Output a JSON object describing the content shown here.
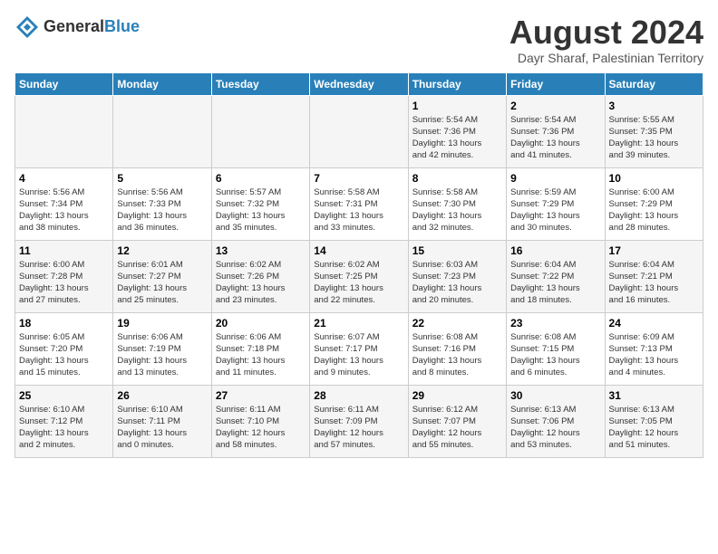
{
  "header": {
    "logo_line1": "General",
    "logo_line2": "Blue",
    "month_title": "August 2024",
    "subtitle": "Dayr Sharaf, Palestinian Territory"
  },
  "days_of_week": [
    "Sunday",
    "Monday",
    "Tuesday",
    "Wednesday",
    "Thursday",
    "Friday",
    "Saturday"
  ],
  "weeks": [
    [
      {
        "day": "",
        "info": ""
      },
      {
        "day": "",
        "info": ""
      },
      {
        "day": "",
        "info": ""
      },
      {
        "day": "",
        "info": ""
      },
      {
        "day": "1",
        "info": "Sunrise: 5:54 AM\nSunset: 7:36 PM\nDaylight: 13 hours\nand 42 minutes."
      },
      {
        "day": "2",
        "info": "Sunrise: 5:54 AM\nSunset: 7:36 PM\nDaylight: 13 hours\nand 41 minutes."
      },
      {
        "day": "3",
        "info": "Sunrise: 5:55 AM\nSunset: 7:35 PM\nDaylight: 13 hours\nand 39 minutes."
      }
    ],
    [
      {
        "day": "4",
        "info": "Sunrise: 5:56 AM\nSunset: 7:34 PM\nDaylight: 13 hours\nand 38 minutes."
      },
      {
        "day": "5",
        "info": "Sunrise: 5:56 AM\nSunset: 7:33 PM\nDaylight: 13 hours\nand 36 minutes."
      },
      {
        "day": "6",
        "info": "Sunrise: 5:57 AM\nSunset: 7:32 PM\nDaylight: 13 hours\nand 35 minutes."
      },
      {
        "day": "7",
        "info": "Sunrise: 5:58 AM\nSunset: 7:31 PM\nDaylight: 13 hours\nand 33 minutes."
      },
      {
        "day": "8",
        "info": "Sunrise: 5:58 AM\nSunset: 7:30 PM\nDaylight: 13 hours\nand 32 minutes."
      },
      {
        "day": "9",
        "info": "Sunrise: 5:59 AM\nSunset: 7:29 PM\nDaylight: 13 hours\nand 30 minutes."
      },
      {
        "day": "10",
        "info": "Sunrise: 6:00 AM\nSunset: 7:29 PM\nDaylight: 13 hours\nand 28 minutes."
      }
    ],
    [
      {
        "day": "11",
        "info": "Sunrise: 6:00 AM\nSunset: 7:28 PM\nDaylight: 13 hours\nand 27 minutes."
      },
      {
        "day": "12",
        "info": "Sunrise: 6:01 AM\nSunset: 7:27 PM\nDaylight: 13 hours\nand 25 minutes."
      },
      {
        "day": "13",
        "info": "Sunrise: 6:02 AM\nSunset: 7:26 PM\nDaylight: 13 hours\nand 23 minutes."
      },
      {
        "day": "14",
        "info": "Sunrise: 6:02 AM\nSunset: 7:25 PM\nDaylight: 13 hours\nand 22 minutes."
      },
      {
        "day": "15",
        "info": "Sunrise: 6:03 AM\nSunset: 7:23 PM\nDaylight: 13 hours\nand 20 minutes."
      },
      {
        "day": "16",
        "info": "Sunrise: 6:04 AM\nSunset: 7:22 PM\nDaylight: 13 hours\nand 18 minutes."
      },
      {
        "day": "17",
        "info": "Sunrise: 6:04 AM\nSunset: 7:21 PM\nDaylight: 13 hours\nand 16 minutes."
      }
    ],
    [
      {
        "day": "18",
        "info": "Sunrise: 6:05 AM\nSunset: 7:20 PM\nDaylight: 13 hours\nand 15 minutes."
      },
      {
        "day": "19",
        "info": "Sunrise: 6:06 AM\nSunset: 7:19 PM\nDaylight: 13 hours\nand 13 minutes."
      },
      {
        "day": "20",
        "info": "Sunrise: 6:06 AM\nSunset: 7:18 PM\nDaylight: 13 hours\nand 11 minutes."
      },
      {
        "day": "21",
        "info": "Sunrise: 6:07 AM\nSunset: 7:17 PM\nDaylight: 13 hours\nand 9 minutes."
      },
      {
        "day": "22",
        "info": "Sunrise: 6:08 AM\nSunset: 7:16 PM\nDaylight: 13 hours\nand 8 minutes."
      },
      {
        "day": "23",
        "info": "Sunrise: 6:08 AM\nSunset: 7:15 PM\nDaylight: 13 hours\nand 6 minutes."
      },
      {
        "day": "24",
        "info": "Sunrise: 6:09 AM\nSunset: 7:13 PM\nDaylight: 13 hours\nand 4 minutes."
      }
    ],
    [
      {
        "day": "25",
        "info": "Sunrise: 6:10 AM\nSunset: 7:12 PM\nDaylight: 13 hours\nand 2 minutes."
      },
      {
        "day": "26",
        "info": "Sunrise: 6:10 AM\nSunset: 7:11 PM\nDaylight: 13 hours\nand 0 minutes."
      },
      {
        "day": "27",
        "info": "Sunrise: 6:11 AM\nSunset: 7:10 PM\nDaylight: 12 hours\nand 58 minutes."
      },
      {
        "day": "28",
        "info": "Sunrise: 6:11 AM\nSunset: 7:09 PM\nDaylight: 12 hours\nand 57 minutes."
      },
      {
        "day": "29",
        "info": "Sunrise: 6:12 AM\nSunset: 7:07 PM\nDaylight: 12 hours\nand 55 minutes."
      },
      {
        "day": "30",
        "info": "Sunrise: 6:13 AM\nSunset: 7:06 PM\nDaylight: 12 hours\nand 53 minutes."
      },
      {
        "day": "31",
        "info": "Sunrise: 6:13 AM\nSunset: 7:05 PM\nDaylight: 12 hours\nand 51 minutes."
      }
    ]
  ]
}
